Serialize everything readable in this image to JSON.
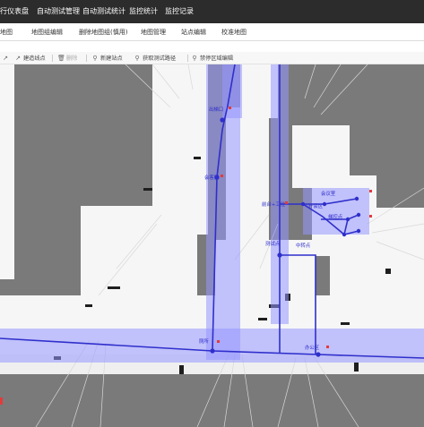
{
  "top_nav": [
    "行仪表盘",
    "自动测试管理",
    "自动测试统计",
    "监控统计",
    "监控记录"
  ],
  "tabs": [
    "地图",
    "地图组编辑",
    "删除地图组(慎用)",
    "地图管理",
    "站点编辑",
    "校准地图"
  ],
  "toolbar": [
    {
      "label": "建造线点",
      "icon": "line-icon",
      "enabled": true
    },
    {
      "label": "删除",
      "icon": "trash-icon",
      "enabled": false
    },
    {
      "label": "新建站点",
      "icon": "pin-icon",
      "enabled": true
    },
    {
      "label": "获取测试路径",
      "icon": "pin-icon",
      "enabled": true
    },
    {
      "label": "禁停区域编辑",
      "icon": "pin-icon",
      "enabled": true
    }
  ],
  "map_labels": [
    "出梯口",
    "会客区",
    "前台+工位",
    "开会区",
    "会议室",
    "梯控点",
    "测试点",
    "中转点",
    "厕所",
    "办公区"
  ],
  "colors": {
    "path": "#2f2fcc",
    "corridor": "rgba(150,150,255,0.55)",
    "nav_bg": "#2c2c2c",
    "map_bg": "#7a7a7a"
  }
}
